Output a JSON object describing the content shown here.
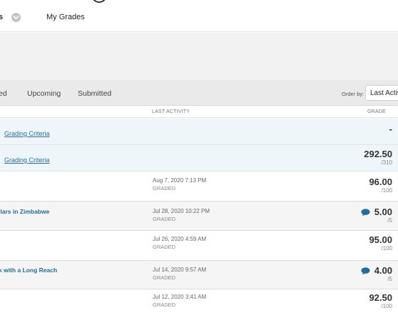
{
  "nav": {
    "cut_label": "s",
    "my_grades": "My Grades"
  },
  "tabs": {
    "cut": "ed",
    "upcoming": "Upcoming",
    "submitted": "Submitted"
  },
  "order_by": {
    "label": "Order by:",
    "value": "Last Activity"
  },
  "columns": {
    "last_activity": "LAST ACTIVITY",
    "grade": "GRADE"
  },
  "rows": [
    {
      "type": "category",
      "link": "Grading Criteria",
      "grade": "-"
    },
    {
      "type": "category",
      "link": "Grading Criteria",
      "score": "292.50",
      "out_of": "/310"
    },
    {
      "type": "item",
      "title": "",
      "date": "Aug 7, 2020 7:13 PM",
      "status": "GRADED",
      "score": "96.00",
      "out_of": "/100"
    },
    {
      "type": "item",
      "title": "llars in Zimbabwe",
      "date": "Jul 28, 2020 10:22 PM",
      "status": "GRADED",
      "score": "5.00",
      "out_of": "/5",
      "comment": true
    },
    {
      "type": "item",
      "title": "",
      "date": "Jul 26, 2020 4:59 AM",
      "status": "GRADED",
      "score": "95.00",
      "out_of": "/100"
    },
    {
      "type": "item",
      "title": "k with a Long Reach",
      "date": "Jul 14, 2020 9:57 AM",
      "status": "GRADED",
      "score": "4.00",
      "out_of": "/5",
      "comment": true
    },
    {
      "type": "item",
      "title": "",
      "date": "Jul 12, 2020 3:41 AM",
      "status": "GRADED",
      "score": "92.50",
      "out_of": "/100"
    }
  ],
  "colors": {
    "link": "#2a6f9e",
    "category_bg": "#eef6f9",
    "comment_icon": "#1f6f9a"
  }
}
